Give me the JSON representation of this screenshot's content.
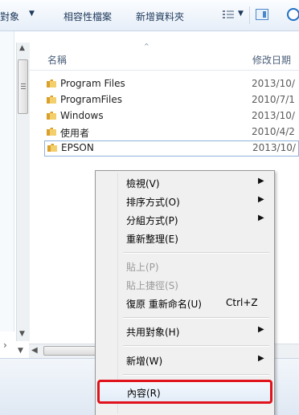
{
  "toolbar": {
    "include_label": "對象",
    "compatibility_label": "相容性檔案",
    "new_folder_label": "新增資料夾"
  },
  "header": {
    "name_col": "名稱",
    "date_col": "修改日期"
  },
  "files": [
    {
      "name": "Program Files",
      "date": "2013/10/"
    },
    {
      "name": "ProgramFiles",
      "date": "2010/7/1"
    },
    {
      "name": "Windows",
      "date": "2013/10/"
    },
    {
      "name": "使用者",
      "date": "2010/4/2"
    },
    {
      "name": "EPSON",
      "date": "2013/10/"
    }
  ],
  "context_menu": {
    "view": "檢視(V)",
    "sort_by": "排序方式(O)",
    "group_by": "分組方式(P)",
    "refresh": "重新整理(E)",
    "paste": "貼上(P)",
    "paste_shortcut": "貼上捷徑(S)",
    "undo_rename": "復原 重新命名(U)",
    "undo_shortcut": "Ctrl+Z",
    "share_with": "共用對象(H)",
    "new": "新增(W)",
    "properties": "內容(R)"
  },
  "colors": {
    "highlight_outline": "#e0121b",
    "folder_yellow": "#e8b84a"
  }
}
